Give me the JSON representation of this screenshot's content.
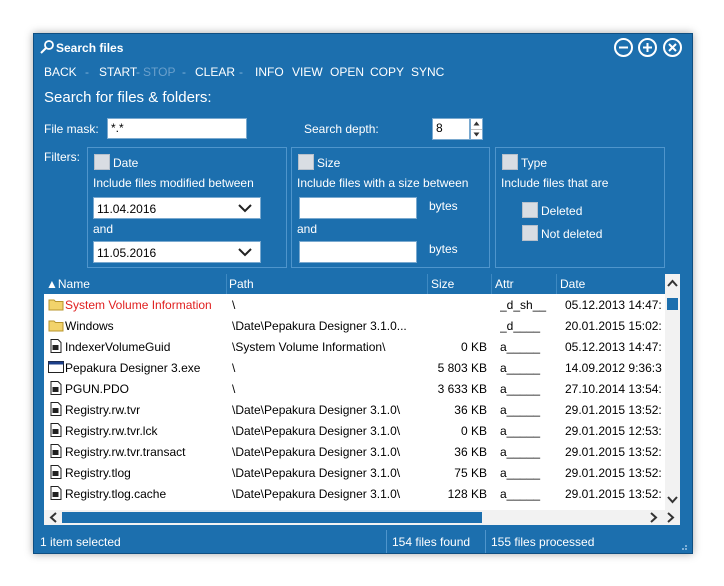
{
  "window": {
    "title": "Search files",
    "controls": [
      "minimize",
      "maximize",
      "close"
    ]
  },
  "toolbar": {
    "back": "BACK",
    "start": "START",
    "stop": "STOP",
    "clear": "CLEAR",
    "info": "INFO",
    "view": "VIEW",
    "open": "OPEN",
    "copy": "COPY",
    "sync": "SYNC",
    "separator": "-"
  },
  "search": {
    "heading": "Search for files & folders:",
    "file_mask_label": "File mask:",
    "file_mask_value": "*.*",
    "depth_label": "Search depth:",
    "depth_value": "8",
    "filters_label": "Filters:"
  },
  "filters": {
    "date": {
      "label": "Date",
      "description": "Include files modified between",
      "from": "11.04.2016",
      "and": "and",
      "to": "11.05.2016"
    },
    "size": {
      "label": "Size",
      "description": "Include files with a size between",
      "from": "",
      "unit1": "bytes",
      "and": "and",
      "to": "",
      "unit2": "bytes"
    },
    "type": {
      "label": "Type",
      "description": "Include files that are",
      "deleted": "Deleted",
      "not_deleted": "Not deleted"
    }
  },
  "list": {
    "columns": [
      "▲Name",
      "Path",
      "Size",
      "Attr",
      "Date"
    ],
    "rows": [
      {
        "icon": "folder",
        "name": "System Volume Information",
        "path": "\\",
        "size": "",
        "attr": "_d_sh__",
        "date": "05.12.2013 14:47:",
        "highlight": true
      },
      {
        "icon": "folder",
        "name": "Windows",
        "path": "\\Date\\Pepakura Designer 3.1.0...",
        "size": "",
        "attr": "_d____",
        "date": "20.01.2015 15:02:"
      },
      {
        "icon": "file",
        "name": "IndexerVolumeGuid",
        "path": "\\System Volume Information\\",
        "size": "0 KB",
        "attr": "a_____",
        "date": "05.12.2013 14:47:"
      },
      {
        "icon": "exe",
        "name": "Pepakura Designer 3.exe",
        "path": "\\",
        "size": "5 803 KB",
        "attr": "a_____",
        "date": "14.09.2012 9:36:3"
      },
      {
        "icon": "file",
        "name": "PGUN.PDO",
        "path": "\\",
        "size": "3 633 KB",
        "attr": "a_____",
        "date": "27.10.2014 13:54:"
      },
      {
        "icon": "file",
        "name": "Registry.rw.tvr",
        "path": "\\Date\\Pepakura Designer 3.1.0\\",
        "size": "36 KB",
        "attr": "a_____",
        "date": "29.01.2015 13:52:"
      },
      {
        "icon": "file",
        "name": "Registry.rw.tvr.lck",
        "path": "\\Date\\Pepakura Designer 3.1.0\\",
        "size": "0 KB",
        "attr": "a_____",
        "date": "29.01.2015 12:53:"
      },
      {
        "icon": "file",
        "name": "Registry.rw.tvr.transact",
        "path": "\\Date\\Pepakura Designer 3.1.0\\",
        "size": "36 KB",
        "attr": "a_____",
        "date": "29.01.2015 13:52:"
      },
      {
        "icon": "file",
        "name": "Registry.tlog",
        "path": "\\Date\\Pepakura Designer 3.1.0\\",
        "size": "75 KB",
        "attr": "a_____",
        "date": "29.01.2015 13:52:"
      },
      {
        "icon": "file",
        "name": "Registry.tlog.cache",
        "path": "\\Date\\Pepakura Designer 3.1.0\\",
        "size": "128 KB",
        "attr": "a_____",
        "date": "29.01.2015 13:52:"
      }
    ]
  },
  "status": {
    "selected": "1 item selected",
    "found": "154 files found",
    "processed": "155 files processed"
  },
  "colors": {
    "window_bg": "#1c6fae",
    "highlight_text": "#e02020"
  }
}
